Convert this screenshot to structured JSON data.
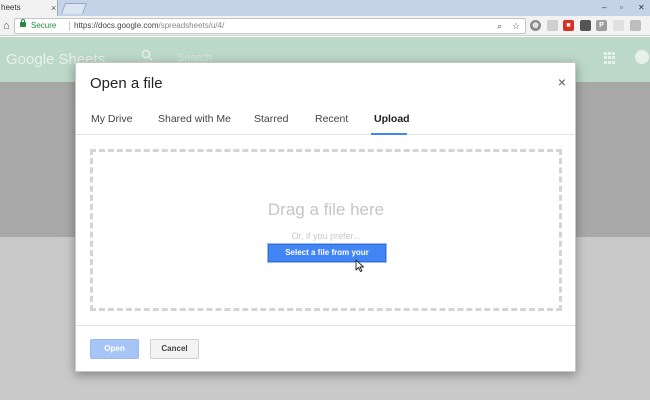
{
  "browser": {
    "tab_title": "heets",
    "tab_close": "×",
    "secure_label": "Secure",
    "url_host": "https://docs.google.com",
    "url_path": "/spreadsheets/u/4/"
  },
  "app": {
    "logo": "Google Sheets",
    "search_placeholder": "Search"
  },
  "dialog": {
    "title": "Open a file",
    "close_label": "×",
    "tabs": [
      {
        "label": "My Drive"
      },
      {
        "label": "Shared with Me"
      },
      {
        "label": "Starred"
      },
      {
        "label": "Recent"
      },
      {
        "label": "Upload",
        "active": true
      }
    ],
    "drop_text": "Drag a file here",
    "or_text": "Or, if you prefer...",
    "select_button": "Select a file from your computer",
    "open_button": "Open",
    "cancel_button": "Cancel"
  },
  "colors": {
    "accent": "#4285f4",
    "app_bar": "#bcd8c8",
    "secure_green": "#1e8e3e"
  }
}
